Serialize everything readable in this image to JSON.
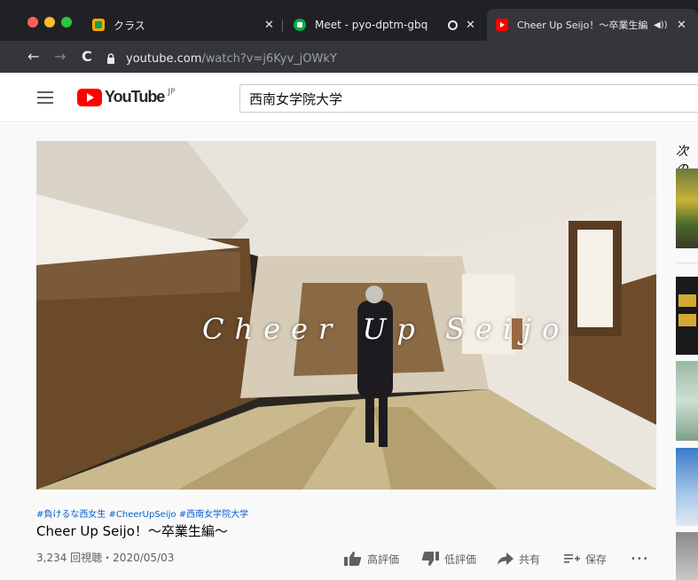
{
  "browser": {
    "tabs": [
      {
        "title": "クラス",
        "icon": "classroom-icon"
      },
      {
        "title": "Meet - pyo-dptm-gbq",
        "icon": "meet-icon"
      },
      {
        "title": "Cheer Up Seijo！〜卒業生編",
        "icon": "youtube-icon",
        "active": true
      }
    ],
    "tab_close": "✕",
    "url_host": "youtube.com",
    "url_path": "/watch?v=j6Kyv_jOWkY"
  },
  "youtube": {
    "logo_text": "YouTube",
    "region": "JP",
    "search_value": "西南女学院大学"
  },
  "video": {
    "overlay_title": "Cheer Up Seijo",
    "hashtags": "#負けるな西女生 #CheerUpSeijo #西南女学院大学",
    "title": "Cheer Up Seijo！〜卒業生編〜",
    "meta": "3,234 回視聴・2020/05/03",
    "actions": {
      "like": "高評価",
      "dislike": "低評価",
      "share": "共有",
      "save": "保存",
      "more": "•••"
    }
  },
  "sidebar": {
    "up_next_label": "次の"
  },
  "colors": {
    "chrome_dark": "#202124",
    "chrome_toolbar": "#35363a",
    "youtube_red": "#ff0000",
    "link_blue": "#065fd4"
  }
}
